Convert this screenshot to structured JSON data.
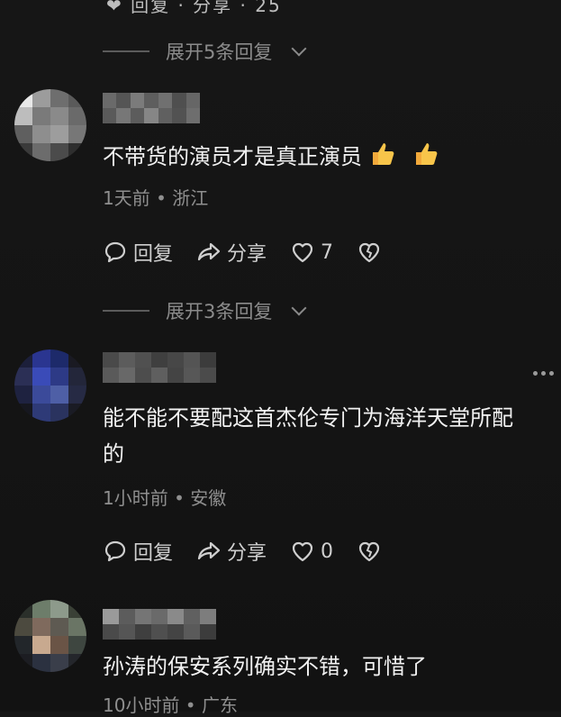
{
  "top_partial": "❤ 回复 · 分享 · 25",
  "comments": [
    {
      "expand_before": "展开5条回复",
      "text": "不带货的演员才是真正演员",
      "emoji": [
        "👍",
        "👍"
      ],
      "meta": "1天前 • 浙江",
      "reply_label": "回复",
      "share_label": "分享",
      "like_count": "7"
    },
    {
      "expand_before": "展开3条回复",
      "text_line1": "能不能不要配这首杰伦专门为海洋天堂所配",
      "text_line2": "的",
      "meta": "1小时前 • 安徽",
      "reply_label": "回复",
      "share_label": "分享",
      "like_count": "0"
    },
    {
      "text": "孙涛的保安系列确实不错，可惜了",
      "meta": "10小时前 • 广东"
    }
  ],
  "icons": {
    "reply": "comment-bubble-icon",
    "share": "share-arrow-icon",
    "like": "heart-icon",
    "dislike": "broken-heart-icon",
    "more": "more-dots-icon"
  },
  "colors": {
    "background": "#141414",
    "text": "#f1f1f1",
    "meta": "#8f8f8f"
  }
}
